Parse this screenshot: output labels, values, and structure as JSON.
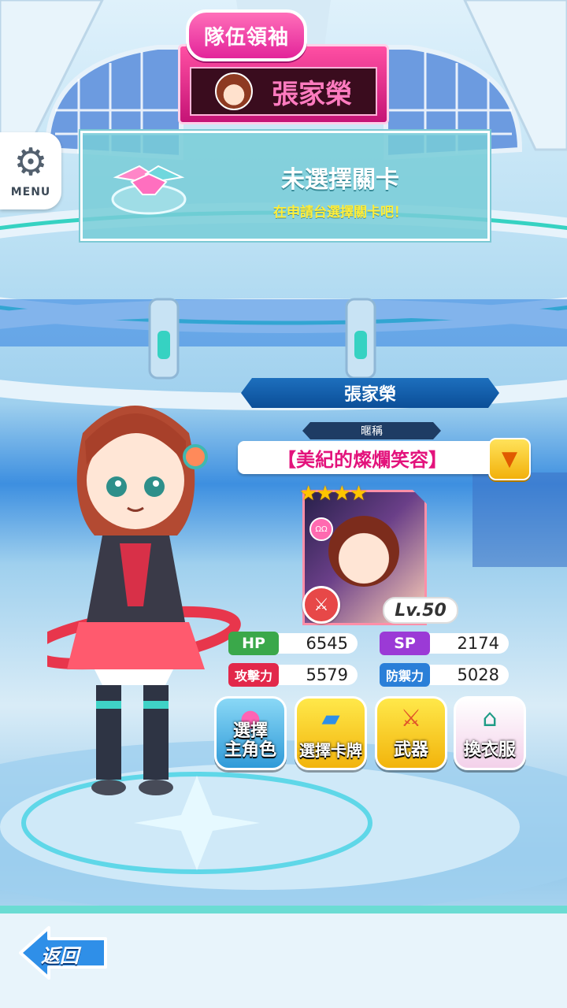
{
  "team_leader": {
    "label": "隊伍領袖",
    "name": "張家榮"
  },
  "menu": {
    "label": "MENU",
    "icon": "gear-icon"
  },
  "stage": {
    "title": "未選擇關卡",
    "subtitle": "在申請台選擇關卡吧！",
    "icon": "handshake-icon"
  },
  "player": {
    "name": "張家榮",
    "title_label": "暱稱",
    "title_value": "【美紀的燦爛笑容】"
  },
  "card": {
    "stars": "★★★★",
    "star_count": 4,
    "level": "Lv.50",
    "badge": "ΩΩ"
  },
  "stats": {
    "hp_label": "HP",
    "hp_value": "6545",
    "sp_label": "SP",
    "sp_value": "2174",
    "atk_label": "攻擊力",
    "atk_value": "5579",
    "def_label": "防禦力",
    "def_value": "5028"
  },
  "actions": {
    "select_character": "選擇\n主角色",
    "select_cards": "選擇卡牌",
    "weapon": "武器",
    "change_outfit": "換衣服"
  },
  "back": {
    "label": "返回"
  },
  "colors": {
    "accent_pink": "#e3137c",
    "hp": "#3aa84a",
    "sp": "#9b3ad6",
    "atk": "#e2284a",
    "def": "#2a7fd8",
    "back_blue": "#2f8fe8"
  }
}
